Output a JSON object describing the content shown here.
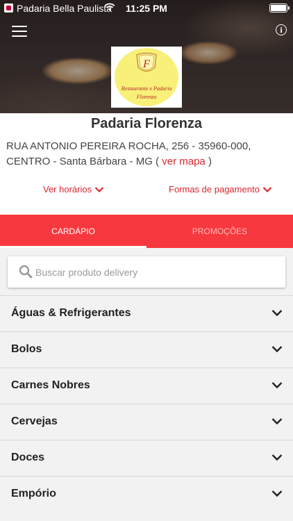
{
  "status_bar": {
    "back_app": "Padaria Bella Paulista",
    "time": "11:25 PM"
  },
  "header": {
    "logo_text_line1": "Restaurante e Padaria",
    "logo_text_line2": "Florenza",
    "logo_monogram": "F"
  },
  "store": {
    "name": "Padaria Florenza",
    "address": "RUA ANTONIO PEREIRA ROCHA, 256 - 35960-000, CENTRO - Santa Bárbara - MG (",
    "map_link": "ver mapa",
    "address_close": ")",
    "hours_link": "Ver horários",
    "payment_link": "Formas de pagamento"
  },
  "tabs": [
    {
      "label": "CARDÁPIO",
      "active": true
    },
    {
      "label": "PROMOÇÕES",
      "active": false
    }
  ],
  "search": {
    "placeholder": "Buscar produto delivery"
  },
  "categories": [
    "Águas & Refrigerantes",
    "Bolos",
    "Carnes Nobres",
    "Cervejas",
    "Doces",
    "Empório"
  ],
  "colors": {
    "accent": "#f7393f",
    "link": "#d9262d"
  }
}
